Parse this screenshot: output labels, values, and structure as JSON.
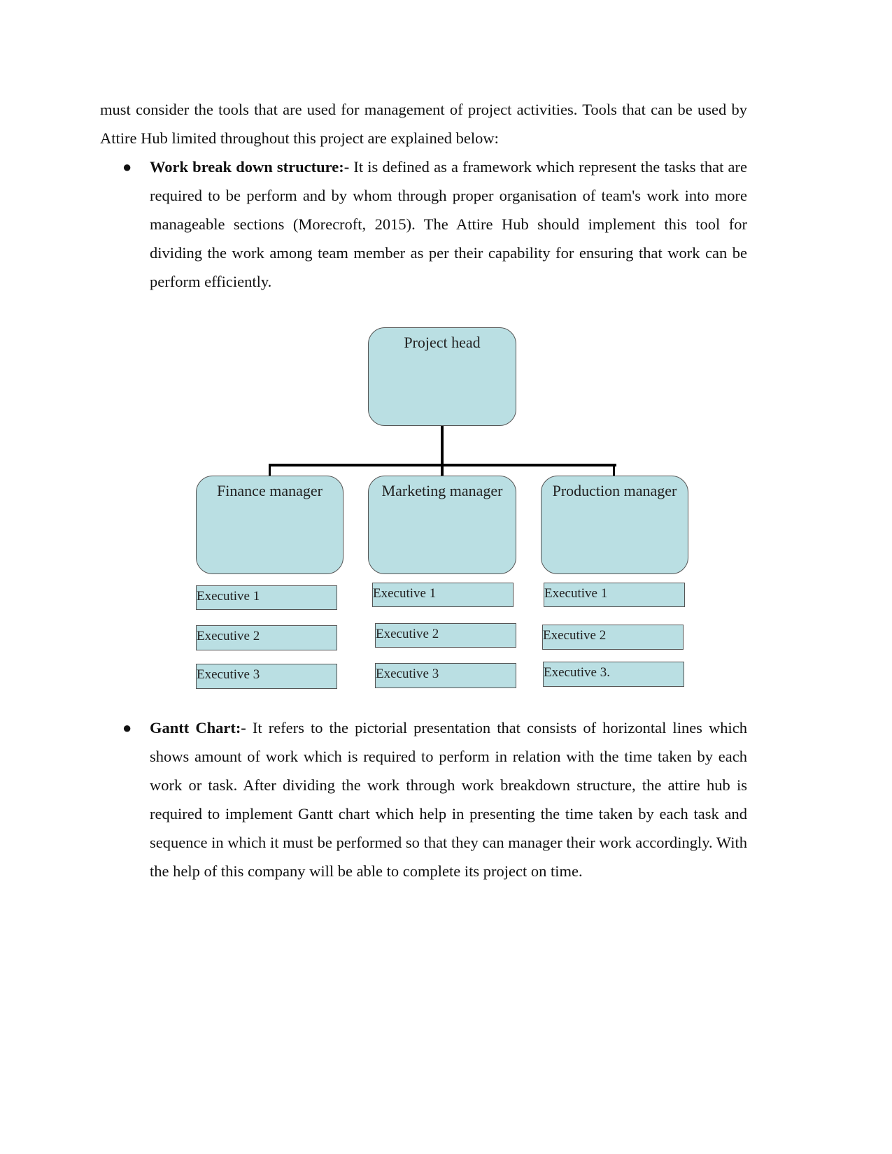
{
  "intro": "must consider the tools that are used for management of project activities. Tools that can be used by Attire Hub limited throughout this project are explained below:",
  "bullets": [
    {
      "term": "Work break down structure:-",
      "text": " It is defined as a framework which represent the tasks that are required to be perform and by whom through proper organisation of team's work into more manageable sections (Morecroft, 2015). The Attire Hub should implement this tool for dividing the work among team member as per their capability for ensuring that work can be perform efficiently."
    },
    {
      "term": "Gantt Chart:-",
      "text": " It refers to the pictorial presentation that consists of horizontal lines which shows amount of work which is required to perform in relation with the time taken by each work or task. After dividing the work through work breakdown structure, the attire hub is required to implement Gantt chart which help in presenting the time taken by each task and sequence in which it must be performed so that they can manager their work accordingly. With the help of this company will be able to complete its project on time."
    }
  ],
  "diagram": {
    "head": "Project head",
    "managers": [
      {
        "title": "Finance manager",
        "executives": [
          "Executive 1",
          "Executive 2",
          "Executive 3"
        ]
      },
      {
        "title": "Marketing manager",
        "executives": [
          "Executive 1",
          "Executive 2",
          "Executive 3"
        ]
      },
      {
        "title": "Production manager",
        "executives": [
          "Executive 1",
          "Executive 2",
          "Executive 3."
        ]
      }
    ],
    "fill_color": "#badfe3"
  }
}
